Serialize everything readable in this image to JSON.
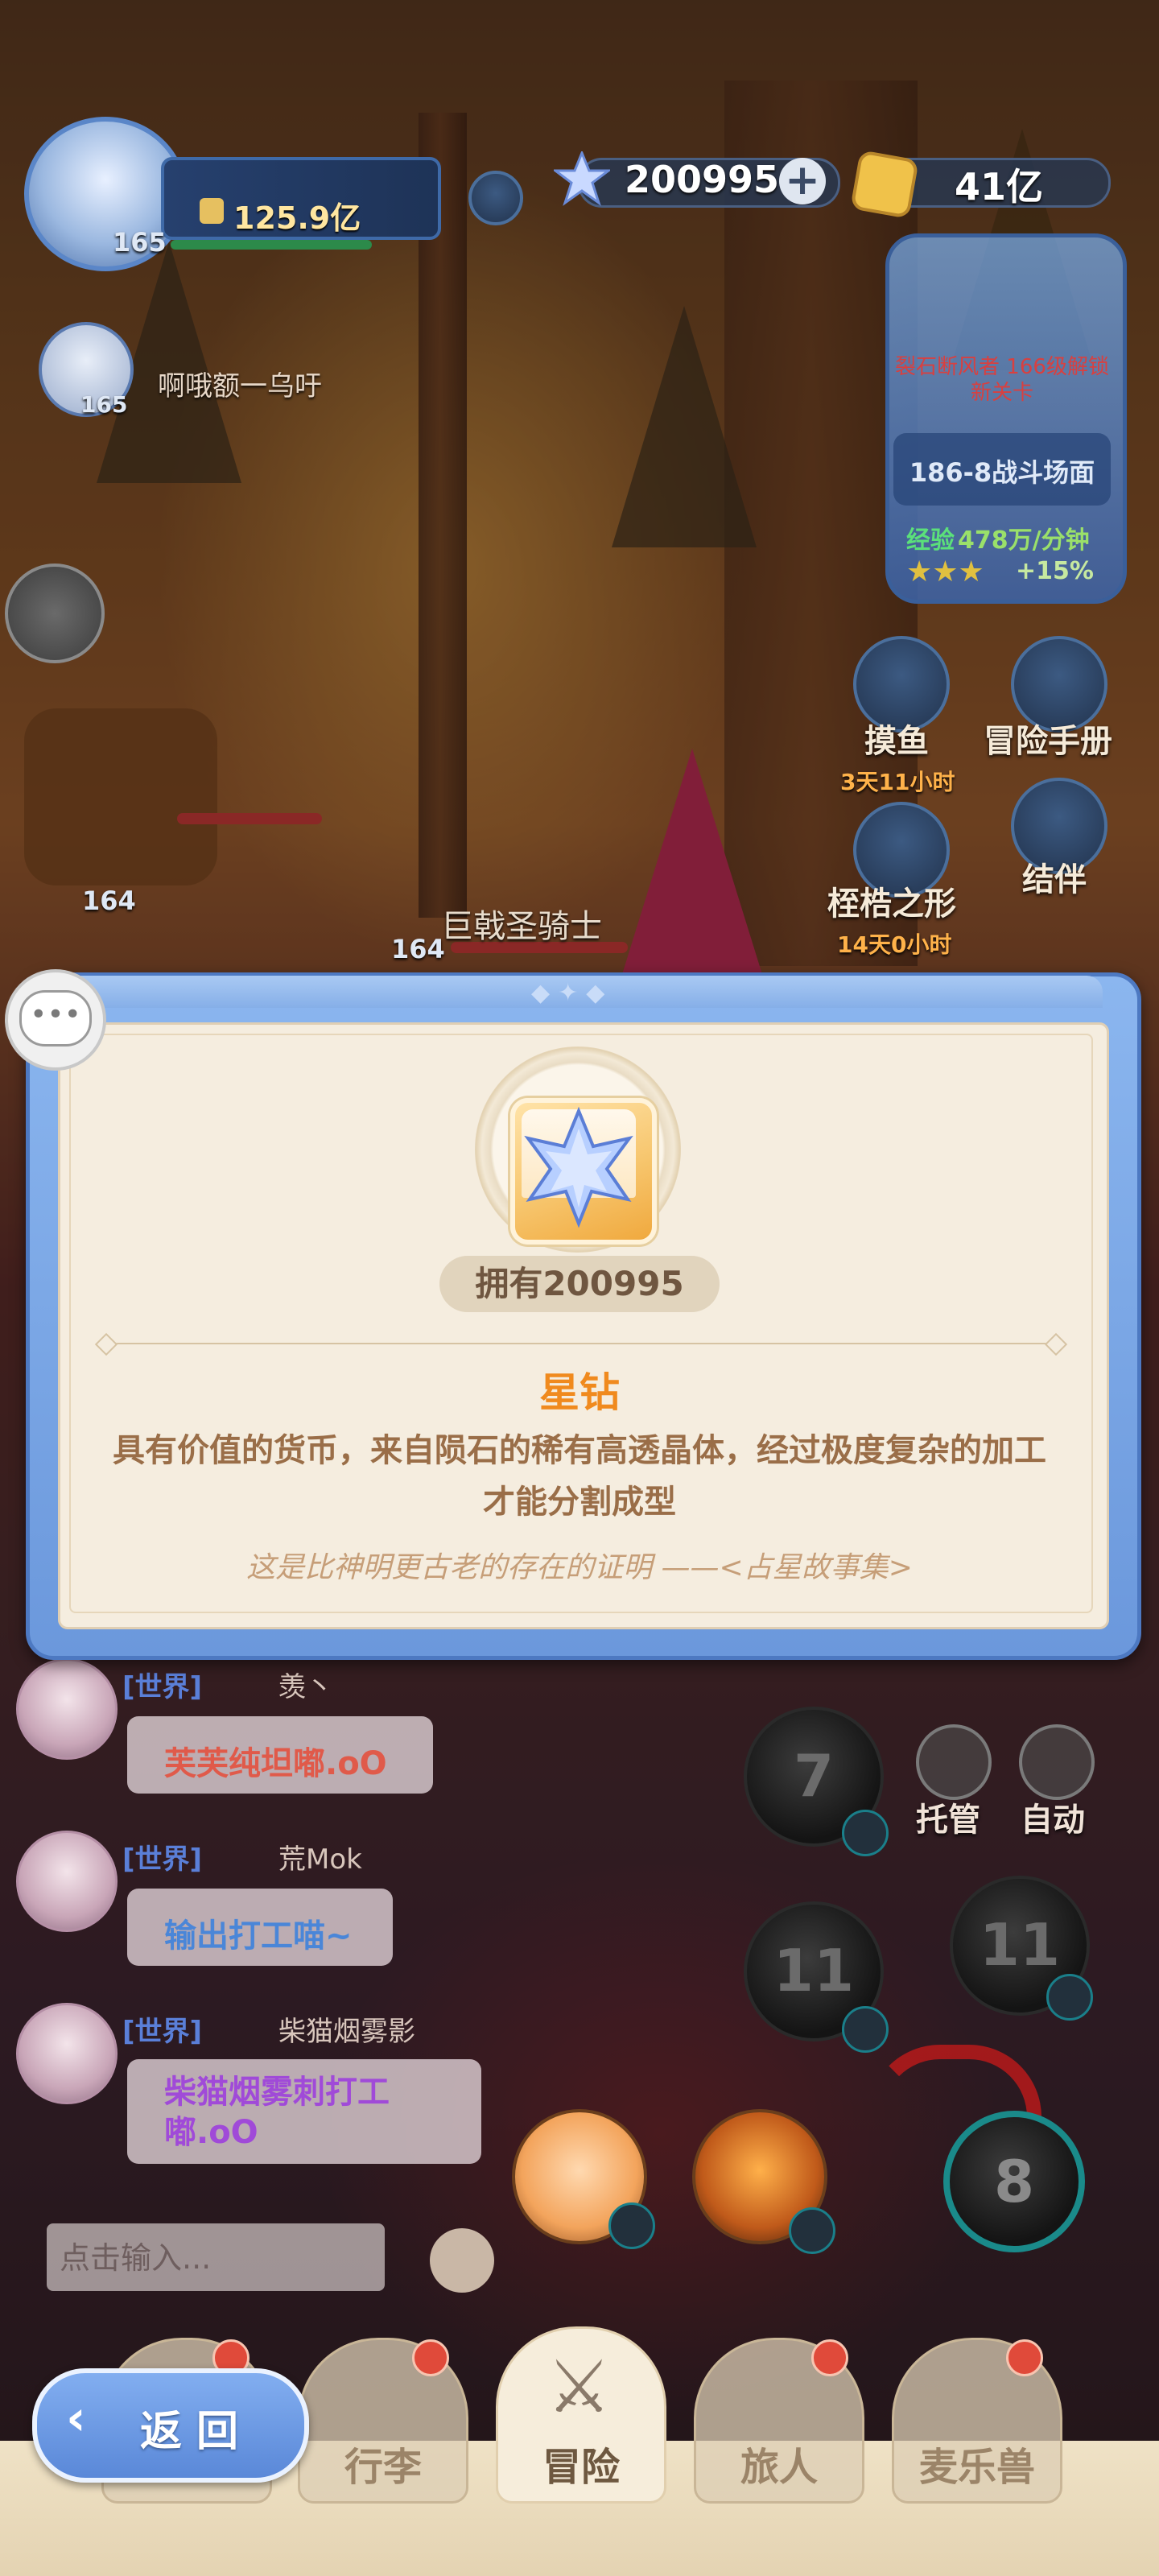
{
  "hud": {
    "player_level": "165",
    "power": "125.9亿",
    "gem_count": "200995",
    "gold_count": "41亿",
    "ally_name": "啊哦额一乌吁",
    "ally_level": "165"
  },
  "stage": {
    "unlock_hint": "裂石断风者 166级解锁新关卡",
    "stage_name": "186-8战斗场面",
    "exp_label": "经验",
    "exp_value": "478万/分钟",
    "bonus": "+15%"
  },
  "side_buttons": [
    {
      "label": "摸鱼",
      "time": "3天11小时"
    },
    {
      "label": "冒险手册",
      "time": ""
    },
    {
      "label": "桎梏之形",
      "time": "14天0小时"
    },
    {
      "label": "结伴",
      "time": ""
    }
  ],
  "battle": {
    "unit_level_1": "164",
    "unit_level_2": "164",
    "enemy_name": "巨戟圣骑士"
  },
  "modal": {
    "owned_text": "拥有200995",
    "item_name": "星钻",
    "description": "具有价值的货币，来自陨石的稀有高透晶体，经过极度复杂的加工才能分割成型",
    "flavor": "这是比神明更古老的存在的证明 ——<占星故事集>"
  },
  "chat": {
    "messages": [
      {
        "channel": "[世界]",
        "user": "羡丶",
        "text": "芙芙纯坦嘟.oO",
        "color": "#e05a4a"
      },
      {
        "channel": "[世界]",
        "user": "荒Mok",
        "text": "输出打工喵~",
        "color": "#4a86d8"
      },
      {
        "channel": "[世界]",
        "user": "柴猫烟雾影",
        "text": "柴猫烟雾刺打工嘟.oO",
        "color": "#a04ad8"
      }
    ],
    "input_placeholder": "点击输入..."
  },
  "skills": {
    "skill_1": "7",
    "skill_2": "11",
    "skill_3": "11",
    "skill_4": "8",
    "auto_manage": "托管",
    "auto": "自动"
  },
  "nav": {
    "tabs": [
      "行李",
      "冒险",
      "旅人",
      "麦乐兽"
    ],
    "back": "返回"
  },
  "colors": {
    "modal_frame": "#6b98dc",
    "modal_bg": "#f5eddf",
    "item_name": "#f08a1e",
    "description": "#9a6e48"
  }
}
